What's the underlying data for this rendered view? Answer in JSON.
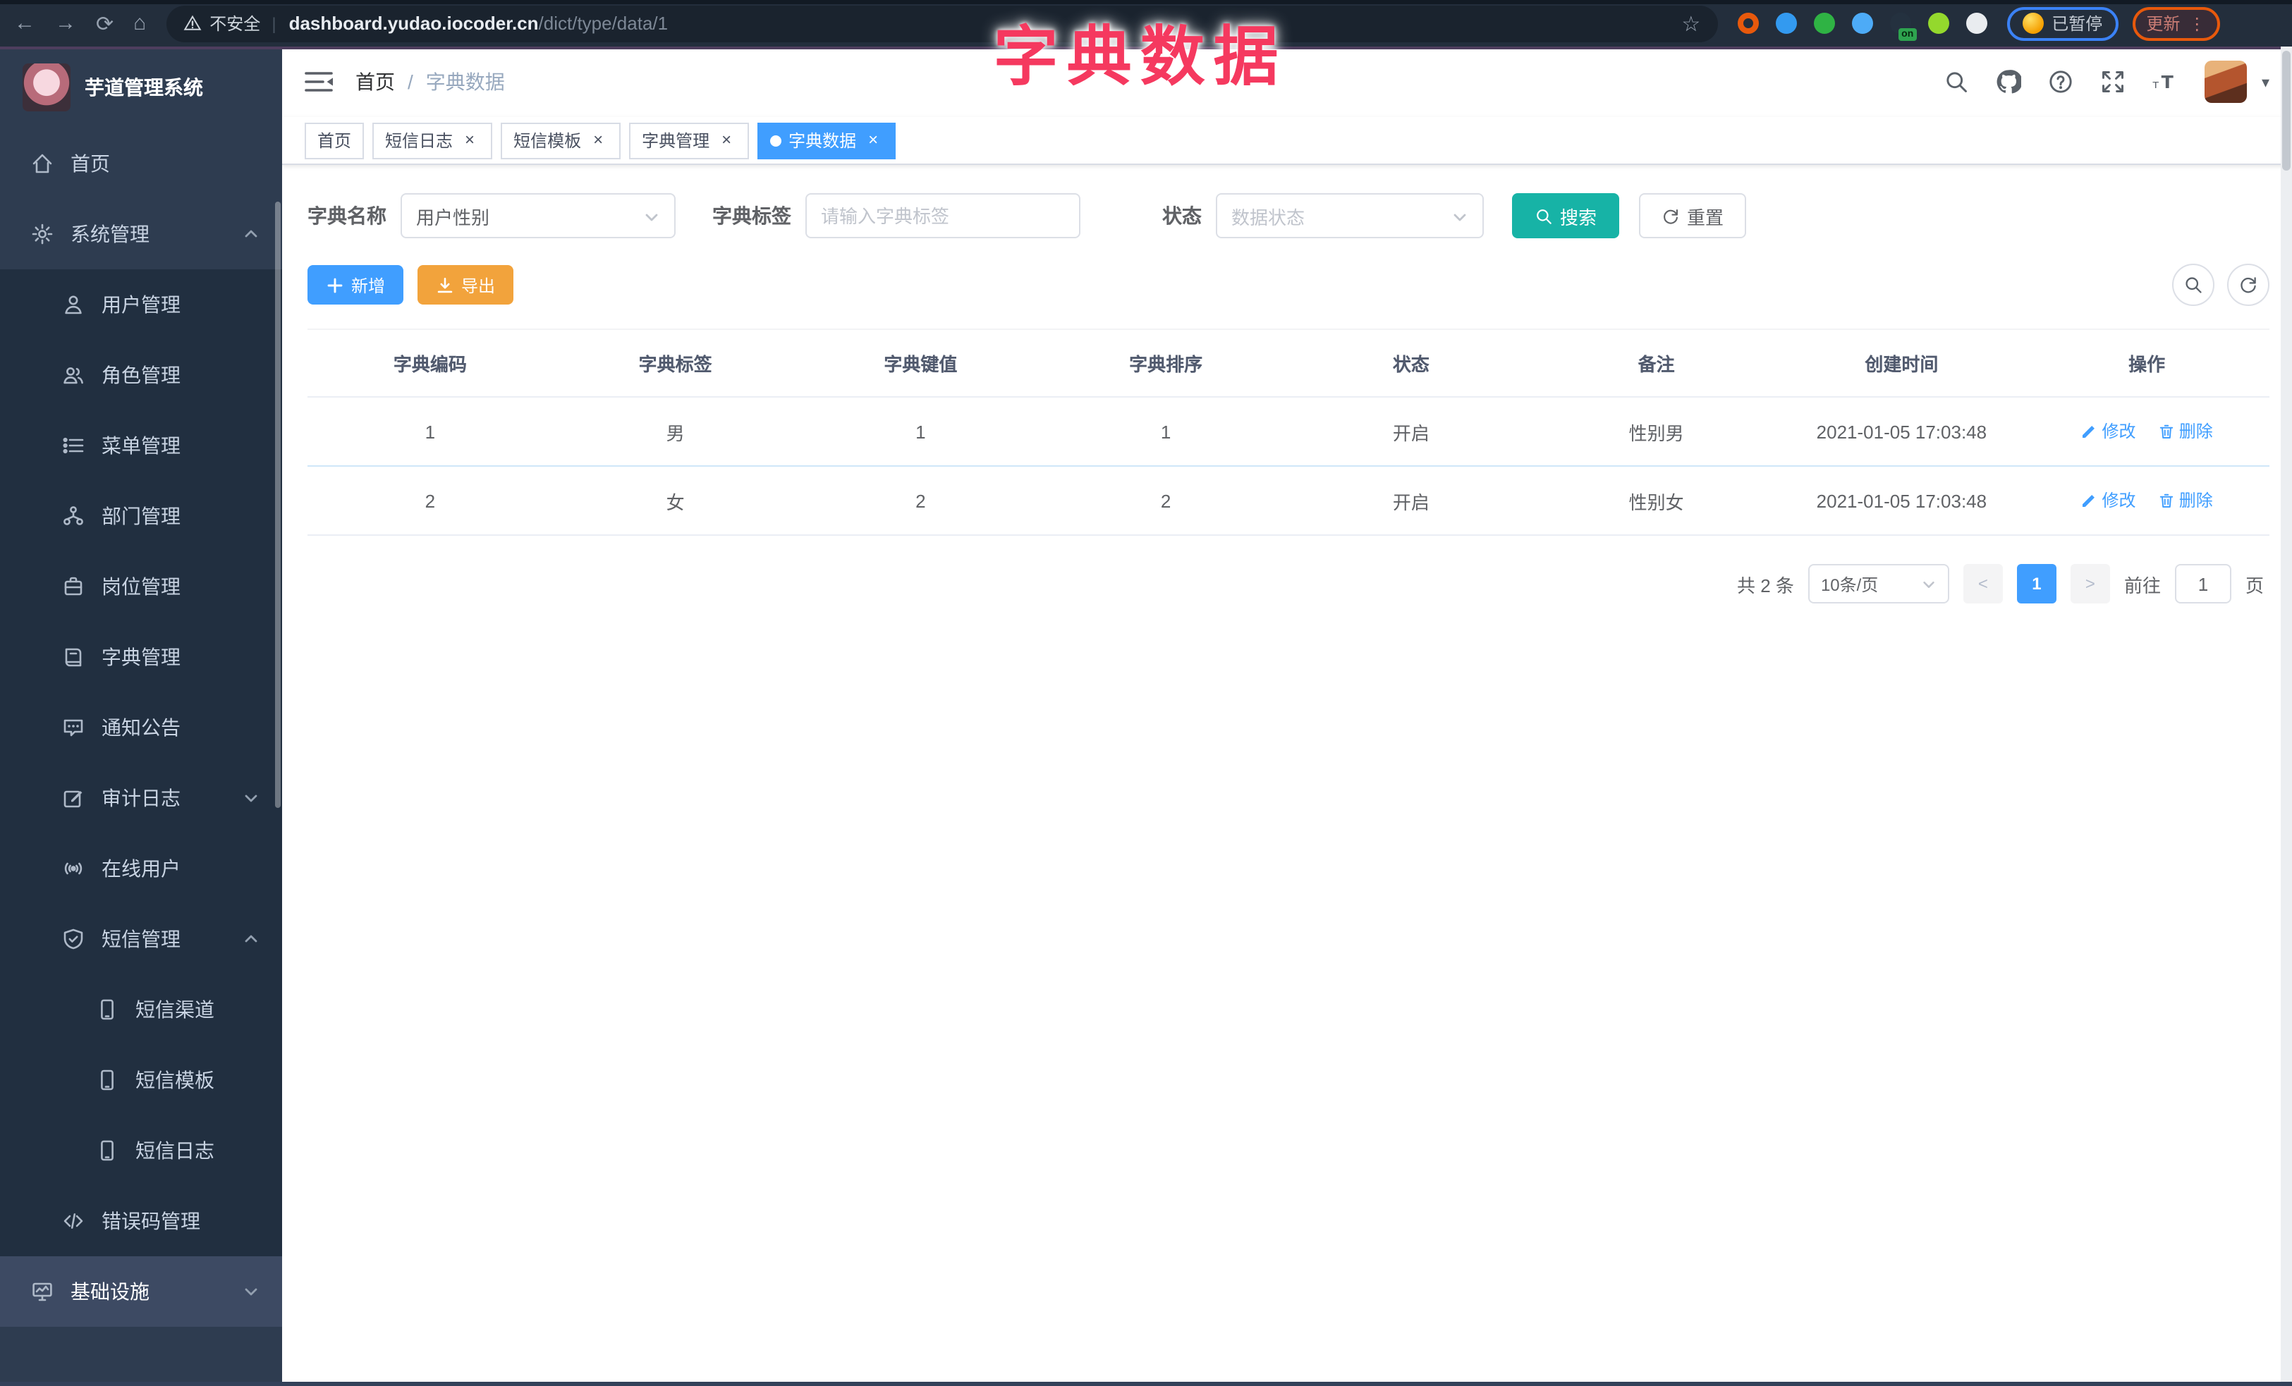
{
  "colors": {
    "accent": "#409eff",
    "teal": "#17b3a6",
    "orange": "#f2a33c",
    "title-pink": "#f5395f",
    "sidebar": "#2e3c50",
    "submenu": "#212f40",
    "sidebar-hl": "#3d4a63"
  },
  "overlay_title": "字典数据",
  "ui": {
    "close": "×",
    "caret": "▾",
    "divider": "|",
    "dots": "⋮",
    "star": "☆",
    "back": "←",
    "forward": "→",
    "reload": "⟳",
    "home": "⌂",
    "prev": "<",
    "next": ">"
  },
  "browser": {
    "security": "不安全",
    "host": "dashboard.yudao.iocoder.cn",
    "path": "/dict/type/data/1",
    "paused": "已暂停",
    "update": "更新",
    "extensions": [
      {
        "name": "extension-orange-icon",
        "color": "#e8590c",
        "ring": true
      },
      {
        "name": "extension-gem-icon",
        "color": "#339af0"
      },
      {
        "name": "extension-shield-icon",
        "color": "#2fb344"
      },
      {
        "name": "extension-sliders-icon",
        "color": "#4dabf7"
      },
      {
        "name": "extension-terminal-icon",
        "color": "#24313f",
        "badge": "on"
      },
      {
        "name": "extension-leaf-icon",
        "color": "#94d82d"
      },
      {
        "name": "puzzle-icon",
        "color": "#e9ecef"
      }
    ]
  },
  "sidebar": {
    "title": "芋道管理系统",
    "items": [
      {
        "label": "首页",
        "icon": "home-icon",
        "level": 1
      },
      {
        "label": "系统管理",
        "icon": "gear-icon",
        "level": 1,
        "chevron": "chevron-up-icon"
      },
      {
        "label": "用户管理",
        "icon": "user-icon",
        "level": 2
      },
      {
        "label": "角色管理",
        "icon": "users-icon",
        "level": 2
      },
      {
        "label": "菜单管理",
        "icon": "menu-list-icon",
        "level": 2
      },
      {
        "label": "部门管理",
        "icon": "org-tree-icon",
        "level": 2
      },
      {
        "label": "岗位管理",
        "icon": "badge-icon",
        "level": 2
      },
      {
        "label": "字典管理",
        "icon": "book-icon",
        "level": 2
      },
      {
        "label": "通知公告",
        "icon": "notice-icon",
        "level": 2
      },
      {
        "label": "审计日志",
        "icon": "audit-log-icon",
        "level": 2,
        "chevron": "chevron-down-icon"
      },
      {
        "label": "在线用户",
        "icon": "online-user-icon",
        "level": 2
      },
      {
        "label": "短信管理",
        "icon": "shield-check-icon",
        "level": 2,
        "chevron": "chevron-up-icon"
      },
      {
        "label": "短信渠道",
        "icon": "phone-icon",
        "level": 3
      },
      {
        "label": "短信模板",
        "icon": "phone-icon",
        "level": 3
      },
      {
        "label": "短信日志",
        "icon": "phone-icon",
        "level": 3
      },
      {
        "label": "错误码管理",
        "icon": "code-icon",
        "level": 2
      },
      {
        "label": "基础设施",
        "icon": "monitor-icon",
        "level": 1,
        "chevron": "chevron-down-icon",
        "hl": true
      }
    ]
  },
  "header": {
    "breadcrumb_root": "首页",
    "breadcrumb_sep": "/",
    "breadcrumb_current": "字典数据"
  },
  "tabs": [
    {
      "label": "首页"
    },
    {
      "label": "短信日志",
      "closable": true
    },
    {
      "label": "短信模板",
      "closable": true
    },
    {
      "label": "字典管理",
      "closable": true
    },
    {
      "label": "字典数据",
      "closable": true,
      "active": true
    }
  ],
  "filters": {
    "name_label": "字典名称",
    "name_value": "用户性别",
    "tag_label": "字典标签",
    "tag_placeholder": "请输入字典标签",
    "status_label": "状态",
    "status_placeholder": "数据状态",
    "search": "搜索",
    "reset": "重置"
  },
  "toolbar": {
    "add": "新增",
    "export": "导出"
  },
  "table": {
    "columns": [
      "字典编码",
      "字典标签",
      "字典键值",
      "字典排序",
      "状态",
      "备注",
      "创建时间",
      "操作"
    ],
    "edit": "修改",
    "delete": "删除",
    "rows": [
      {
        "code": "1",
        "label": "男",
        "value": "1",
        "sort": "1",
        "status": "开启",
        "remark": "性别男",
        "created": "2021-01-05 17:03:48"
      },
      {
        "code": "2",
        "label": "女",
        "value": "2",
        "sort": "2",
        "status": "开启",
        "remark": "性别女",
        "created": "2021-01-05 17:03:48"
      }
    ]
  },
  "pagination": {
    "total": "共 2 条",
    "size": "10条/页",
    "page": "1",
    "goto": "前往",
    "goto_value": "1",
    "unit": "页"
  }
}
